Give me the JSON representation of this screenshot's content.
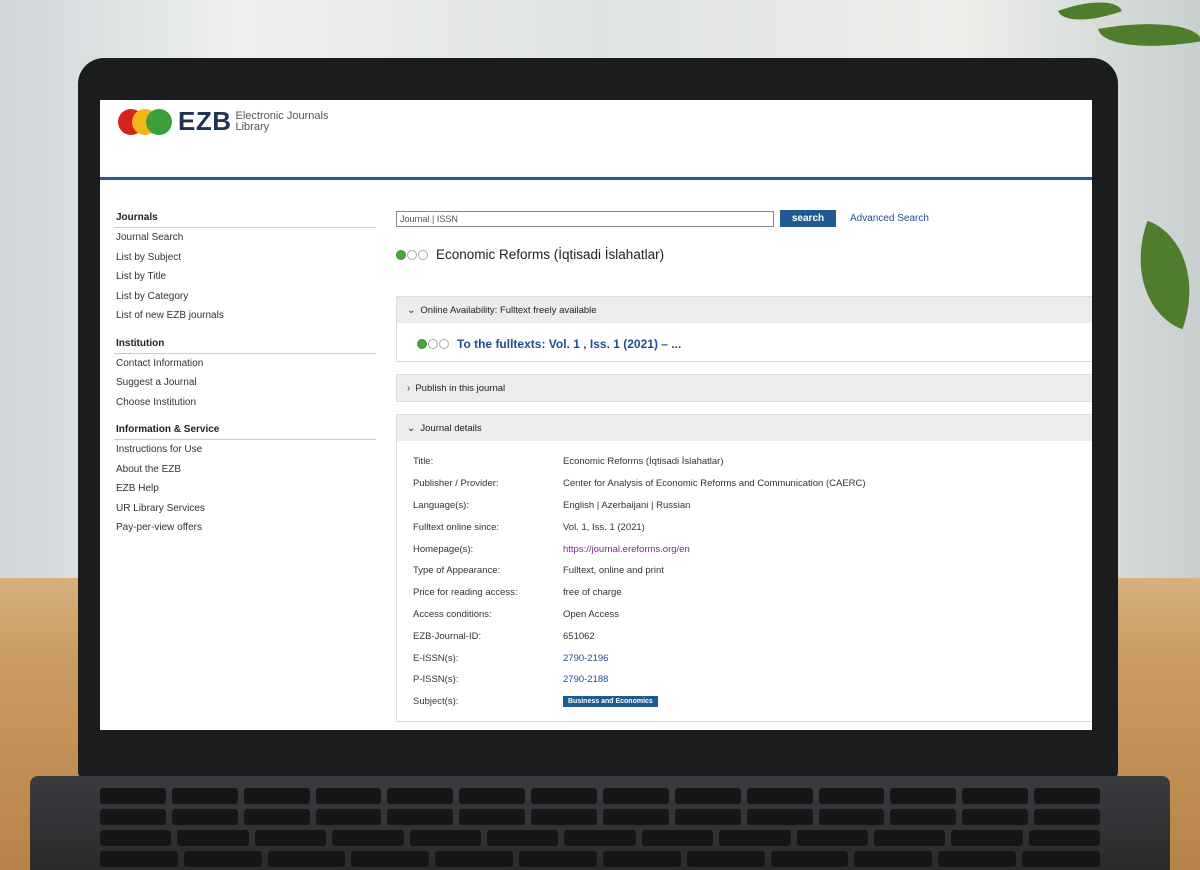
{
  "logo": {
    "mark": "EZB",
    "subtitle": "Electronic Journals Library"
  },
  "sidebar": {
    "groups": [
      {
        "title": "Journals",
        "items": [
          "Journal Search",
          "List by Subject",
          "List by Title",
          "List by Category",
          "List of new EZB journals"
        ]
      },
      {
        "title": "Institution",
        "items": [
          "Contact Information",
          "Suggest a Journal",
          "Choose Institution"
        ]
      },
      {
        "title": "Information & Service",
        "items": [
          "Instructions for Use",
          "About the EZB",
          "EZB Help",
          "UR Library Services",
          "Pay-per-view offers"
        ]
      }
    ]
  },
  "search": {
    "value": "Journal | ISSN",
    "button": "search",
    "advanced": "Advanced Search"
  },
  "journal": {
    "title": "Economic Reforms (İqtisadi İslahatlar)"
  },
  "panels": {
    "online": {
      "label": "Online Availability: Fulltext freely available",
      "link": "To the fulltexts: Vol. 1 , Iss. 1 (2021) – ..."
    },
    "publish": {
      "label": "Publish in this journal"
    },
    "details": {
      "label": "Journal details"
    }
  },
  "details": [
    {
      "label": "Title:",
      "value": "Economic Reforms (İqtisadi İslahatlar)"
    },
    {
      "label": "Publisher / Provider:",
      "value": "Center for Analysis of Economic Reforms and Communication (CAERC)"
    },
    {
      "label": "Language(s):",
      "value": "English | Azerbaijani | Russian"
    },
    {
      "label": "Fulltext online since:",
      "value": "Vol. 1, Iss. 1 (2021)"
    },
    {
      "label": "Homepage(s):",
      "value": "https://journal.ereforms.org/en"
    },
    {
      "label": "Type of Appearance:",
      "value": "Fulltext, online and print"
    },
    {
      "label": "Price for reading access:",
      "value": "free of charge"
    },
    {
      "label": "Access conditions:",
      "value": "Open Access"
    },
    {
      "label": "EZB-Journal-ID:",
      "value": "651062"
    },
    {
      "label": "E-ISSN(s):",
      "value": "2790-2196"
    },
    {
      "label": "P-ISSN(s):",
      "value": "2790-2188"
    },
    {
      "label": "Subject(s):",
      "value": "Business and Economics"
    }
  ],
  "colors": {
    "accent": "#1f5a92",
    "link": "#1f4f8e",
    "available": "#4aa53b"
  }
}
